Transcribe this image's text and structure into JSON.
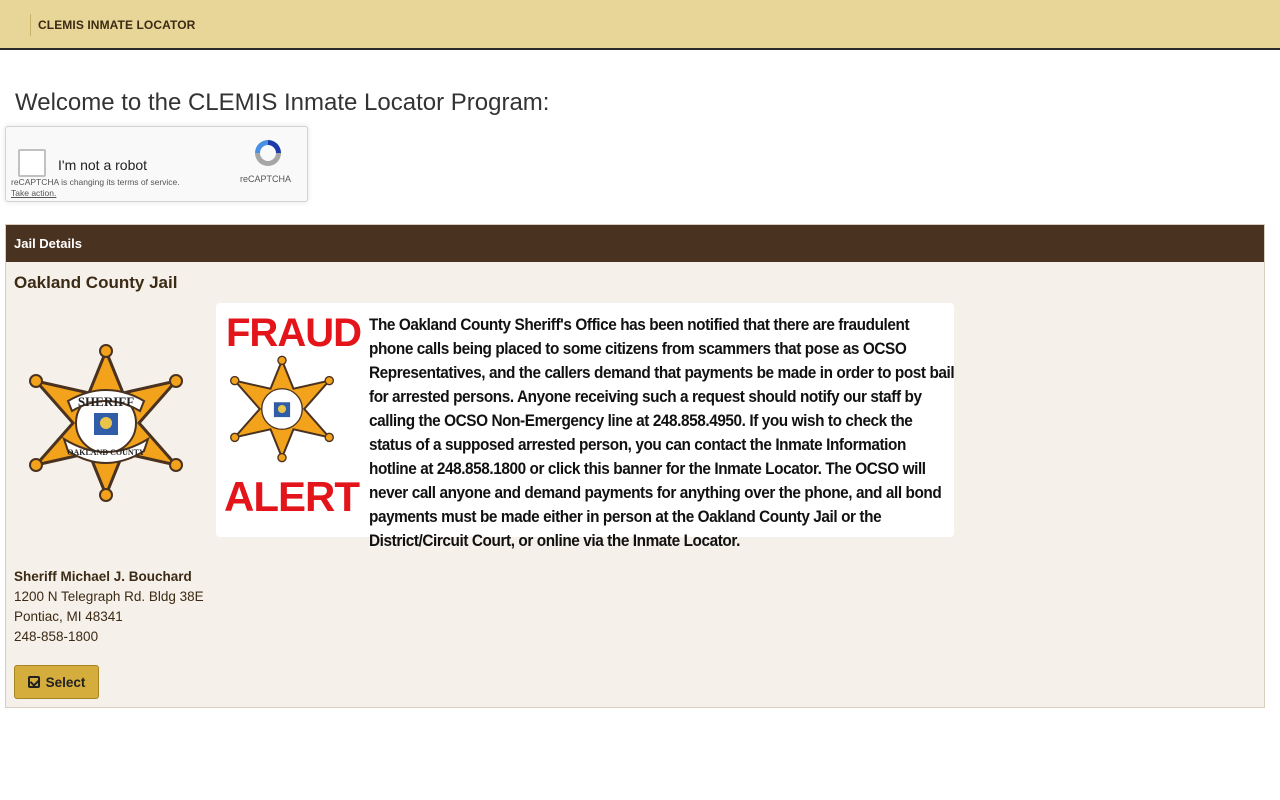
{
  "header": {
    "brand": "CLEMIS INMATE LOCATOR"
  },
  "welcome": "Welcome to the CLEMIS Inmate Locator Program:",
  "captcha": {
    "checkbox_label": "I'm not a robot",
    "terms_text": "reCAPTCHA is changing its terms of service.",
    "take_action": "Take action.",
    "brand": "reCAPTCHA"
  },
  "panel": {
    "title": "Jail Details",
    "jail_name": "Oakland County Jail",
    "banner": {
      "fraud": "FRAUD",
      "alert": "ALERT",
      "message": "The Oakland County Sheriff's Office has been notified that there are fraudulent phone calls being placed to some citizens from scammers that pose as OCSO Representatives, and the callers demand that payments be made in order to post bail for arrested persons. Anyone receiving such a request should notify our staff by calling the OCSO Non-Emergency line at 248.858.4950.  If you wish to check the status of a supposed arrested person, you can contact the Inmate Information hotline at 248.858.1800 or click this banner for the Inmate Locator.  The OCSO will never call anyone and demand payments for anything over the phone, and all bond payments must be made either in person at the Oakland County Jail or the District/Circuit Court, or online via the Inmate Locator."
    },
    "address": {
      "name": "Sheriff Michael J. Bouchard",
      "street": "1200 N Telegraph Rd. Bldg 38E",
      "city": "Pontiac, MI 48341",
      "phone": "248-858-1800"
    },
    "select_label": "Select"
  },
  "colors": {
    "header_bg": "#e8d598",
    "panel_head": "#4a3220",
    "fraud_red": "#e3151a",
    "button": "#d4ad3d"
  },
  "icons": {
    "select": "check-square-icon",
    "captcha": "recaptcha-icon",
    "badge": "sheriff-badge-icon"
  },
  "badge_text": {
    "top": "SHERIFF",
    "bottom": "OAKLAND COUNTY"
  }
}
